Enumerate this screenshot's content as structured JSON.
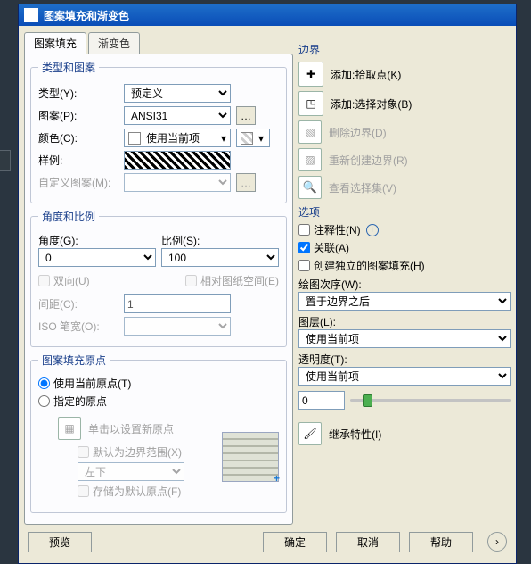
{
  "window": {
    "title": "图案填充和渐变色"
  },
  "tabs": {
    "hatch": "图案填充",
    "gradient": "渐变色"
  },
  "type_pattern": {
    "legend": "类型和图案",
    "type_label": "类型(Y):",
    "type_value": "预定义",
    "pattern_label": "图案(P):",
    "pattern_value": "ANSI31",
    "color_label": "颜色(C):",
    "color_value": "使用当前项",
    "sample_label": "样例:",
    "custom_label": "自定义图案(M):"
  },
  "angle_scale": {
    "legend": "角度和比例",
    "angle_label": "角度(G):",
    "angle_value": "0",
    "scale_label": "比例(S):",
    "scale_value": "100",
    "double_label": "双向(U)",
    "paper_label": "相对图纸空间(E)",
    "spacing_label": "间距(C):",
    "spacing_value": "1",
    "iso_label": "ISO 笔宽(O):"
  },
  "origin": {
    "legend": "图案填充原点",
    "use_current": "使用当前原点(T)",
    "specified": "指定的原点",
    "click_set": "单击以设置新原点",
    "default_extent": "默认为边界范围(X)",
    "default_value": "左下",
    "store_default": "存储为默认原点(F)"
  },
  "boundary": {
    "title": "边界",
    "add_pick": "添加:拾取点(K)",
    "add_select": "添加:选择对象(B)",
    "remove": "删除边界(D)",
    "recreate": "重新创建边界(R)",
    "view_sel": "查看选择集(V)"
  },
  "options": {
    "title": "选项",
    "annotative": "注释性(N)",
    "associative": "关联(A)",
    "independent": "创建独立的图案填充(H)",
    "draw_order_label": "绘图次序(W):",
    "draw_order_value": "置于边界之后",
    "layer_label": "图层(L):",
    "layer_value": "使用当前项",
    "transparency_label": "透明度(T):",
    "transparency_value": "使用当前项",
    "transparency_num": "0",
    "inherit": "继承特性(I)"
  },
  "buttons": {
    "preview": "预览",
    "ok": "确定",
    "cancel": "取消",
    "help": "帮助"
  }
}
